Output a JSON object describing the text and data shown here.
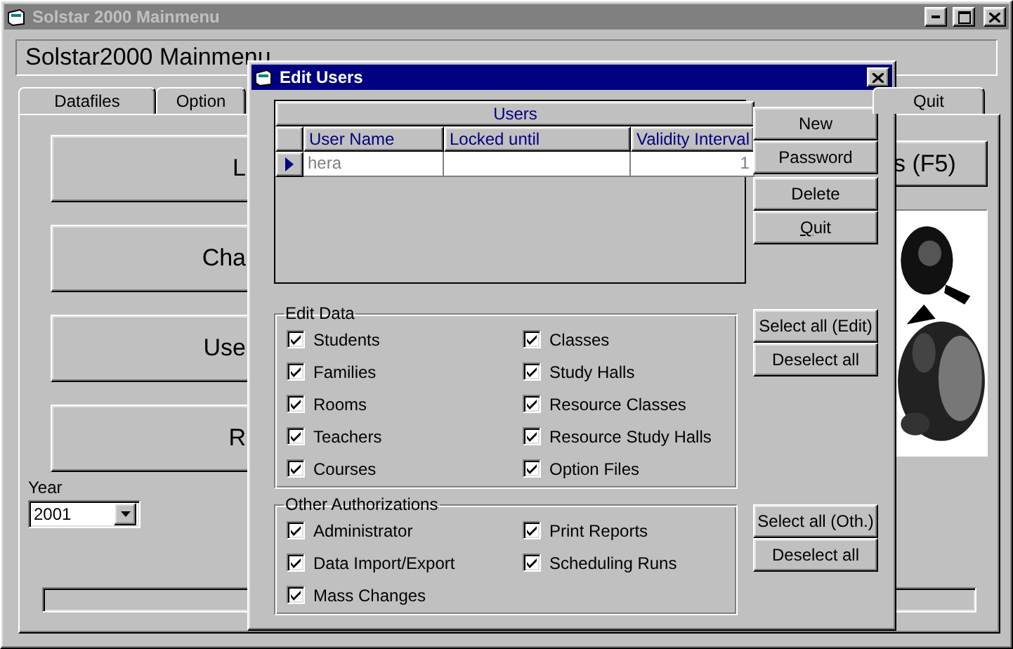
{
  "main_window": {
    "title": "Solstar 2000 Mainmenu",
    "header": "Solstar2000 Mainmenu",
    "tabs": [
      {
        "label": "Datafiles",
        "selected": false
      },
      {
        "label": "Option",
        "selected": false
      },
      {
        "label": "Quit",
        "selected": false
      }
    ],
    "menu_buttons": [
      "L",
      "Cha",
      "Use",
      "R"
    ],
    "side_button": "s (F5)",
    "year": {
      "label": "Year",
      "value": "2001"
    },
    "picture": {
      "kind": "picture"
    }
  },
  "dialog": {
    "title": "Edit Users",
    "users_table": {
      "caption": "Users",
      "columns": [
        "User Name",
        "Locked until",
        "Validity Interval"
      ],
      "rows": [
        {
          "selected": true,
          "user_name": "hera",
          "validity_interval": "1"
        }
      ]
    },
    "buttons": [
      {
        "label": "New",
        "underline_first": false
      },
      {
        "label": "Password",
        "underline_first": false
      },
      {
        "label": "Delete",
        "underline_first": false
      },
      {
        "label": "Quit",
        "underline_first": true
      }
    ],
    "groups": [
      {
        "legend": "Edit Data",
        "select_all": "Select all (Edit)",
        "deselect_all": "Deselect all",
        "items": [
          {
            "label": "Students",
            "checked": true
          },
          {
            "label": "Families",
            "checked": true
          },
          {
            "label": "Rooms",
            "checked": true
          },
          {
            "label": "Teachers",
            "checked": true
          },
          {
            "label": "Courses",
            "checked": true
          },
          {
            "label": "Classes",
            "checked": true
          },
          {
            "label": "Study Halls",
            "checked": true
          },
          {
            "label": "Resource Classes",
            "checked": true
          },
          {
            "label": "Resource Study Halls",
            "checked": true
          },
          {
            "label": "Option Files",
            "checked": true
          }
        ]
      },
      {
        "legend": "Other Authorizations",
        "select_all": "Select all (Oth.)",
        "deselect_all": "Deselect all",
        "items": [
          {
            "label": "Administrator",
            "checked": true
          },
          {
            "label": "Data Import/Export",
            "checked": true
          },
          {
            "label": "Mass Changes",
            "checked": true
          },
          {
            "label": "Print Reports",
            "checked": true
          },
          {
            "label": "Scheduling Runs",
            "checked": true
          }
        ]
      }
    ]
  }
}
